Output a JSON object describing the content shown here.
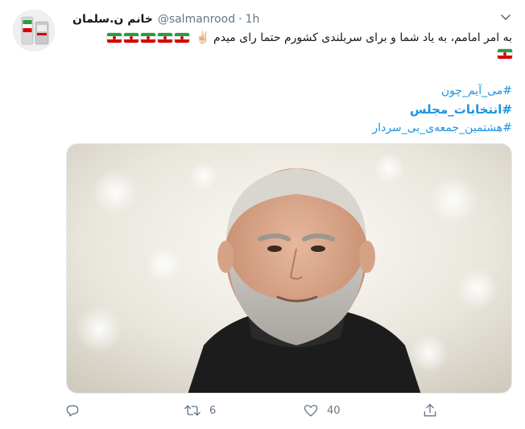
{
  "user": {
    "display_name": "خانم ن.سلمان",
    "handle": "@salmanrood",
    "separator": "·",
    "time": "1h"
  },
  "tweet": {
    "text": "به امر امامم، به یاد شما و برای سربلندی کشورم حتما رای میدم ✌🏻",
    "flags_line1": 5,
    "flags_line2": 1,
    "hashtags": [
      "#می_آیم_چون",
      "#انتخابات_مجلس",
      "#هشتمین_جمعه‌ی_بی_سردار"
    ]
  },
  "actions": {
    "reply_count": "",
    "retweet_count": "6",
    "like_count": "40"
  },
  "icons": {
    "reply": "reply-icon",
    "retweet": "retweet-icon",
    "like": "heart-icon",
    "share": "share-icon",
    "menu": "chevron-down-icon"
  },
  "colors": {
    "link": "#1b95e0",
    "secondary_text": "#657786",
    "flag_green": "#239f40",
    "flag_red": "#da0000"
  }
}
